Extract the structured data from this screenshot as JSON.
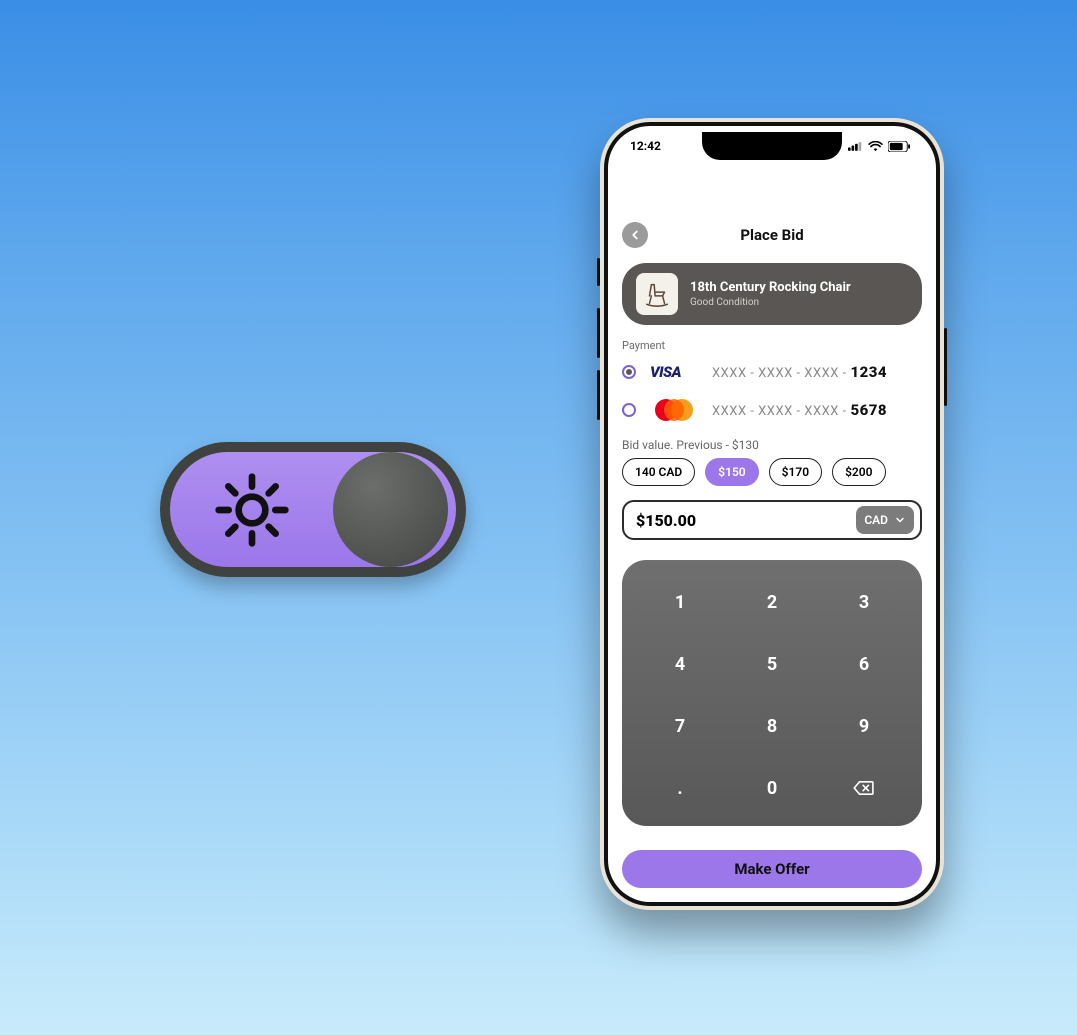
{
  "theme_toggle": {
    "state": "light"
  },
  "statusbar": {
    "time": "12:42"
  },
  "header": {
    "title": "Place Bid"
  },
  "item": {
    "name": "18th Century Rocking Chair",
    "subtitle": "Good Condition"
  },
  "payment": {
    "label": "Payment",
    "methods": [
      {
        "type": "visa",
        "mask": "XXXX - XXXX - XXXX - ",
        "last4": "1234",
        "selected": true
      },
      {
        "type": "mastercard",
        "mask": "XXXX - XXXX - XXXX - ",
        "last4": "5678",
        "selected": false
      }
    ]
  },
  "bid": {
    "label": "Bid value. Previous - $130",
    "chips": [
      {
        "label": "140 CAD",
        "active": false
      },
      {
        "label": "$150",
        "active": true
      },
      {
        "label": "$170",
        "active": false
      },
      {
        "label": "$200",
        "active": false
      }
    ],
    "amount": "$150.00",
    "currency": "CAD"
  },
  "keypad": {
    "keys": [
      "1",
      "2",
      "3",
      "4",
      "5",
      "6",
      "7",
      "8",
      "9",
      ".",
      "0",
      "backspace"
    ]
  },
  "cta": {
    "label": "Make Offer"
  },
  "colors": {
    "accent": "#9b77ea",
    "dark_gray": "#595653"
  }
}
